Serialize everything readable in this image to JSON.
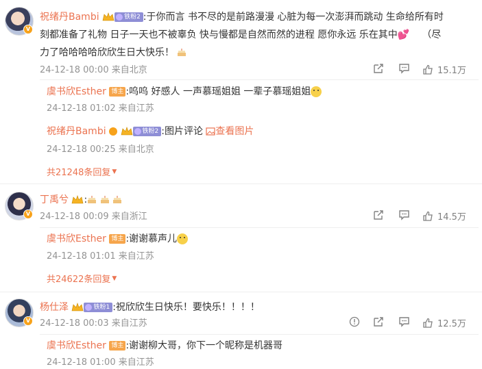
{
  "comments": [
    {
      "name": "祝绪丹Bambi",
      "fan_badge": "铁粉2",
      "text_line1": ":于你而言 书不尽的是前路漫漫 心脏为每一次澎湃而跳动  生命给所有时",
      "text_line2": "刻都准备了礼物 日子一天也不被辜负 快与慢都是自然而然的进程 愿你永远 乐在其中",
      "text_line3_a": "（尽",
      "text_line3": "力了哈哈哈哈欣欣生日大快乐！",
      "meta": "24-12-18 00:00 来自北京",
      "likes": "15.1万",
      "replies": [
        {
          "name": "虞书欣Esther",
          "tag": "博主",
          "text": ":呜呜 好感人 一声慕瑶姐姐 一辈子慕瑶姐姐",
          "meta": "24-12-18 01:02 来自江苏"
        },
        {
          "name": "祝绪丹Bambi",
          "fan_badge": "铁粉2",
          "text": ":图片评论",
          "link": "查看图片",
          "meta": "24-12-18 00:25 来自北京"
        }
      ],
      "more": "共21248条回复"
    },
    {
      "name": "丁禹兮",
      "meta": "24-12-18 00:09 来自浙江",
      "likes": "14.5万",
      "replies": [
        {
          "name": "虞书欣Esther",
          "tag": "博主",
          "text": ":谢谢慕声儿",
          "meta": "24-12-18 01:01 来自江苏"
        }
      ],
      "more": "共24622条回复"
    },
    {
      "name": "杨仕泽",
      "fan_badge": "铁粉1",
      "text": ":祝欣欣生日快乐！要快乐！！！！",
      "meta": "24-12-18 00:03 来自江苏",
      "likes": "12.5万",
      "replies": [
        {
          "name": "虞书欣Esther",
          "tag": "博主",
          "text": ":谢谢柳大哥，你下一个昵称是机器哥",
          "meta": "24-12-18 01:00 来自江苏"
        }
      ]
    }
  ],
  "icons": {
    "share": "share-icon",
    "comment": "comment-icon",
    "like": "like-icon",
    "report": "report-icon"
  },
  "colors": {
    "name": "#eb7350",
    "meta": "#939393",
    "text": "#333333"
  }
}
